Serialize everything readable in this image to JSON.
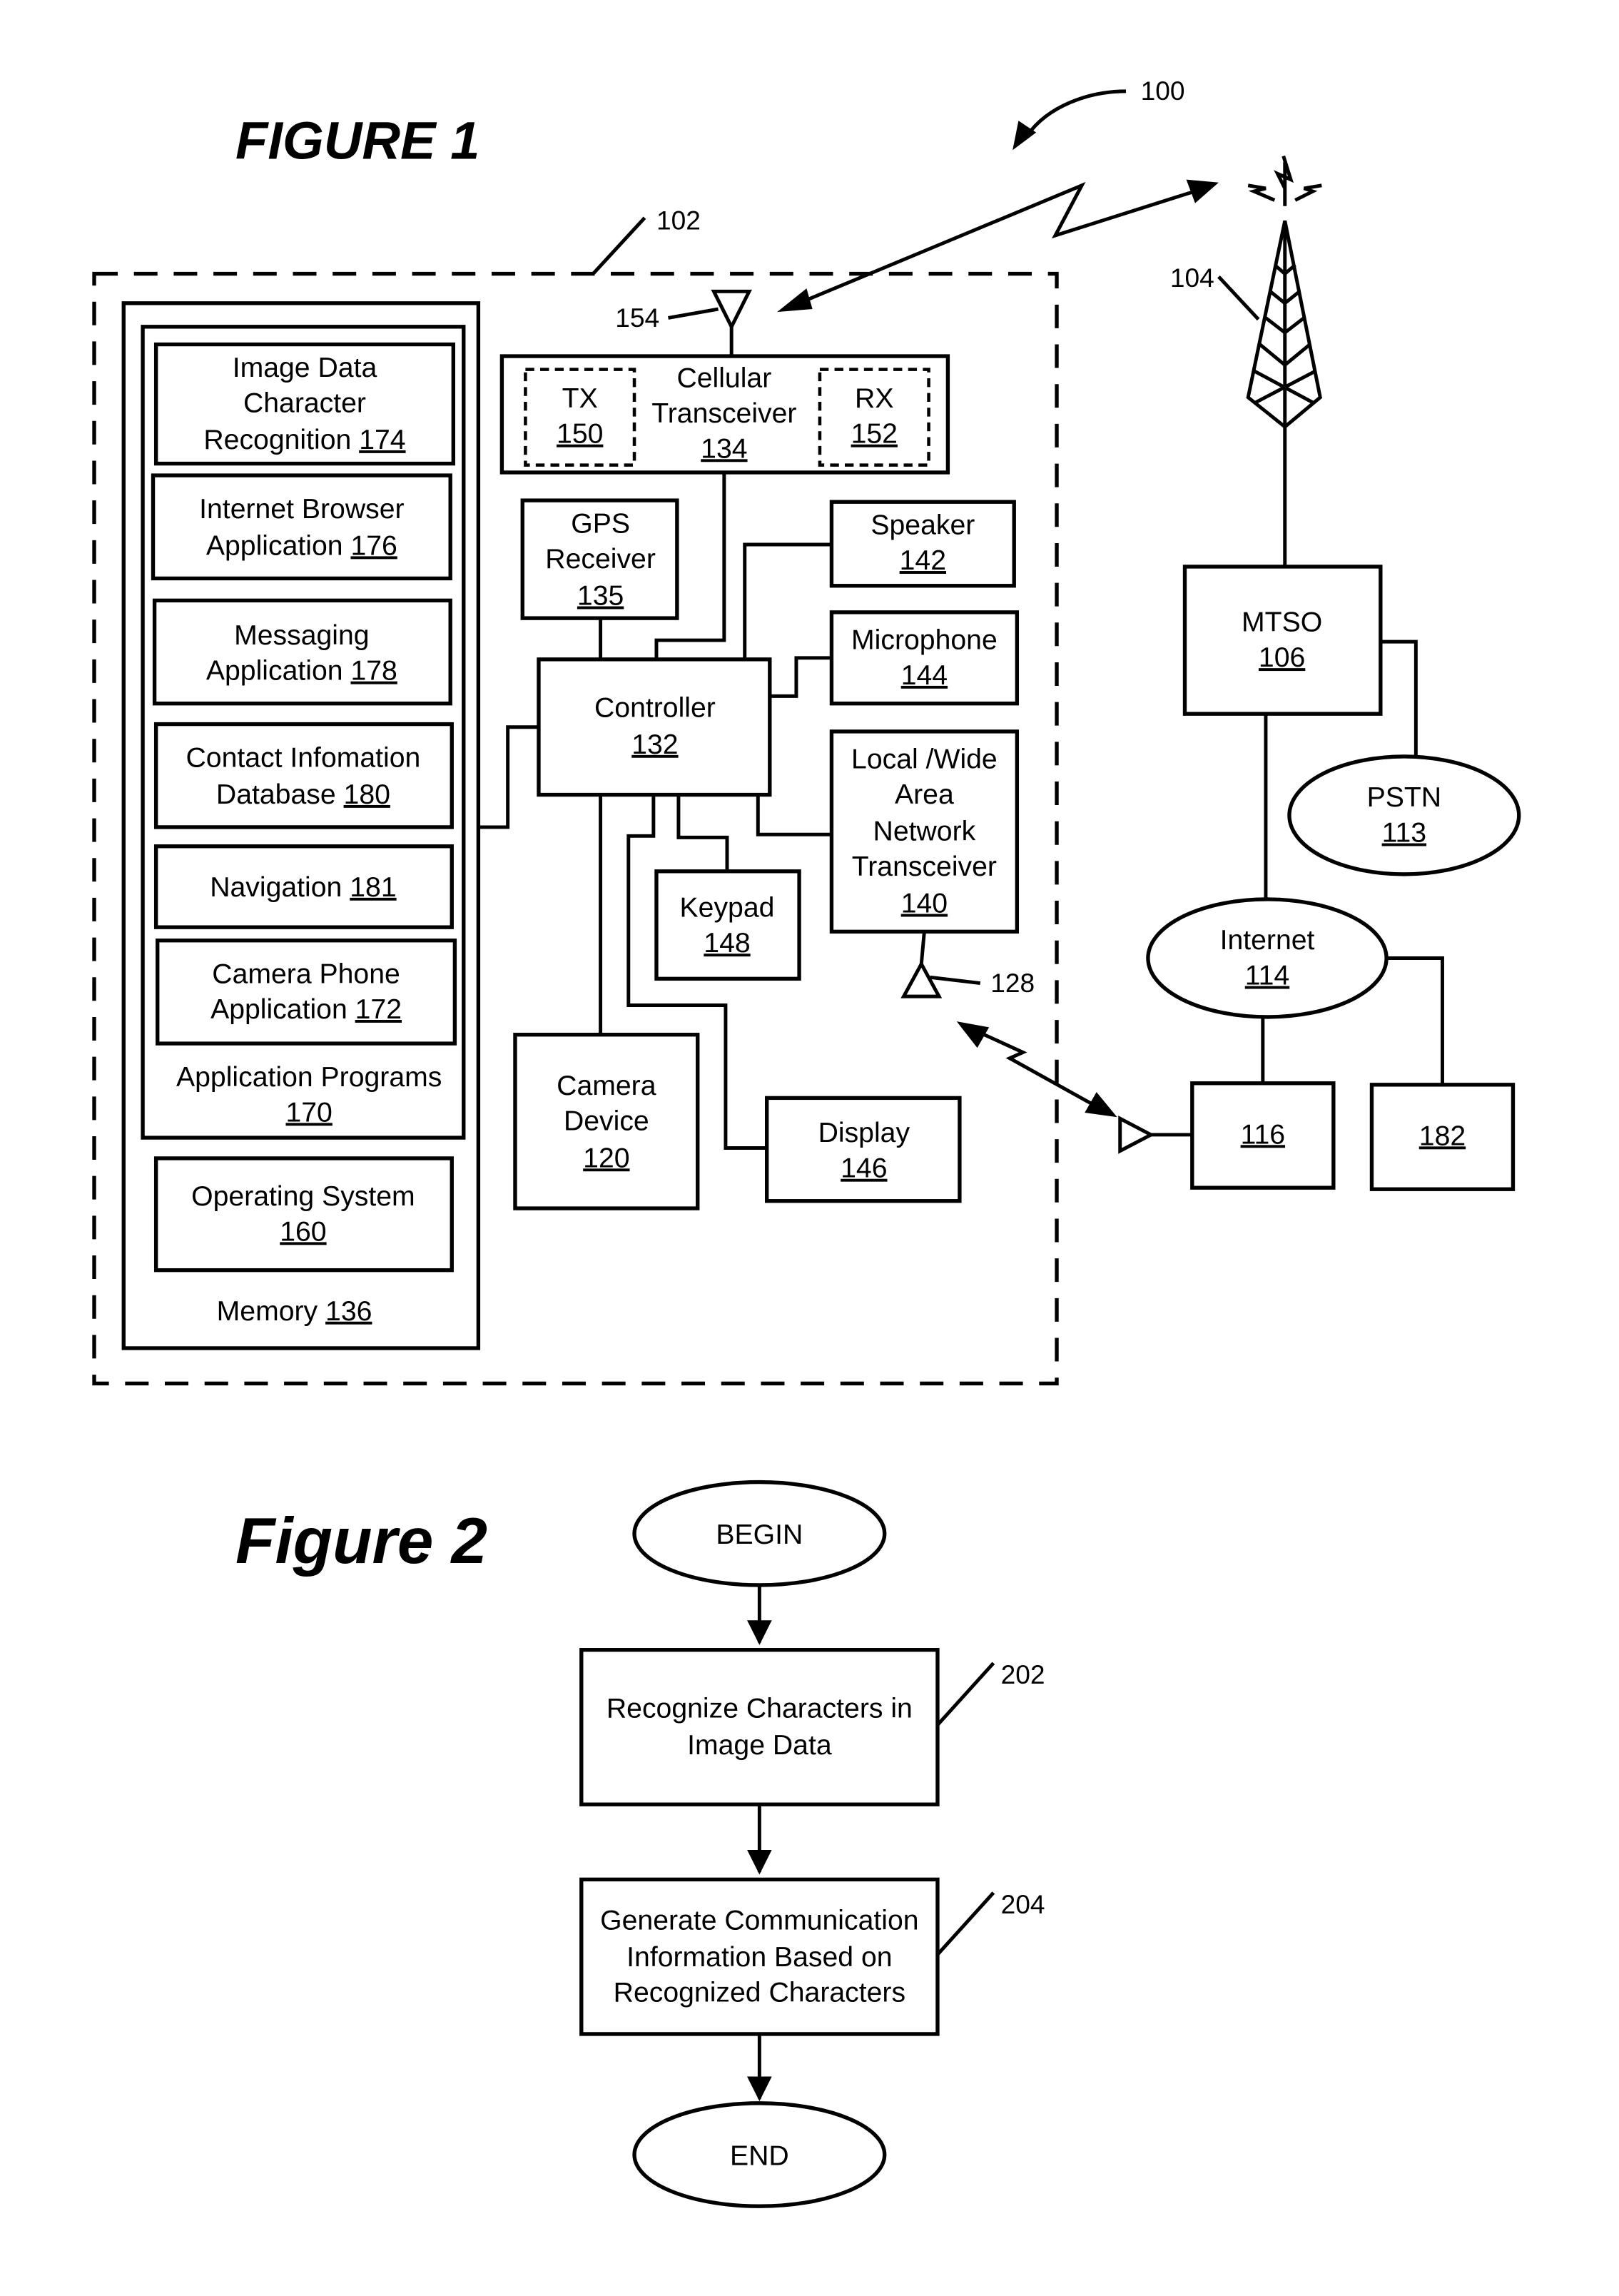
{
  "figure1": {
    "title": "FIGURE 1",
    "system_ref": "100",
    "device_ref": "102",
    "tower_ref": "104",
    "antenna_cellular_ref": "154",
    "antenna_local_ref": "128",
    "memory": {
      "label": "Memory",
      "num": "136",
      "application_programs": {
        "label": "Application Programs",
        "num": "170"
      },
      "apps": [
        {
          "lines": [
            "Image Data",
            "Character",
            "Recognition"
          ],
          "num": "174"
        },
        {
          "lines": [
            "Internet Browser",
            "Application"
          ],
          "num": "176"
        },
        {
          "lines": [
            "Messaging",
            "Application"
          ],
          "num": "178"
        },
        {
          "lines": [
            "Contact Infomation",
            "Database"
          ],
          "num": "180"
        },
        {
          "lines": [
            "Navigation"
          ],
          "num": "181"
        },
        {
          "lines": [
            "Camera Phone",
            "Application"
          ],
          "num": "172"
        }
      ],
      "operating_system": {
        "label": "Operating System",
        "num": "160"
      }
    },
    "cellular_transceiver": {
      "line1": "Cellular",
      "line2": "Transceiver",
      "num": "134",
      "tx": {
        "label": "TX",
        "num": "150"
      },
      "rx": {
        "label": "RX",
        "num": "152"
      }
    },
    "gps": {
      "line1": "GPS",
      "line2": "Receiver",
      "num": "135"
    },
    "controller": {
      "label": "Controller",
      "num": "132"
    },
    "speaker": {
      "label": "Speaker",
      "num": "142"
    },
    "microphone": {
      "label": "Microphone",
      "num": "144"
    },
    "lan_transceiver": {
      "lines": [
        "Local /Wide",
        "Area",
        "Network",
        "Transceiver"
      ],
      "num": "140"
    },
    "keypad": {
      "label": "Keypad",
      "num": "148"
    },
    "camera": {
      "line1": "Camera",
      "line2": "Device",
      "num": "120"
    },
    "display": {
      "label": "Display",
      "num": "146"
    },
    "mtso": {
      "label": "MTSO",
      "num": "106"
    },
    "pstn": {
      "label": "PSTN",
      "num": "113"
    },
    "internet": {
      "label": "Internet",
      "num": "114"
    },
    "node116": {
      "num": "116"
    },
    "node182": {
      "num": "182"
    }
  },
  "figure2": {
    "title": "Figure 2",
    "begin": "BEGIN",
    "end": "END",
    "steps": [
      {
        "lines": [
          "Recognize Characters in",
          "Image Data"
        ],
        "ref": "202"
      },
      {
        "lines": [
          "Generate Communication",
          "Information Based on",
          "Recognized Characters"
        ],
        "ref": "204"
      }
    ]
  }
}
